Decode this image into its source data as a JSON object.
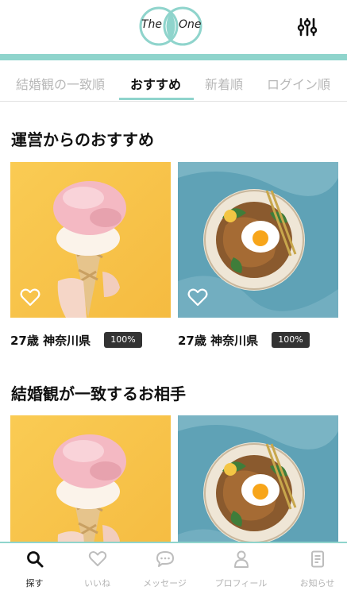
{
  "header": {
    "logo": {
      "word1": "The",
      "word2": "One"
    },
    "filter_icon": "sliders-icon",
    "accent_color": "#8fd4cc"
  },
  "tabs": [
    {
      "label": "結婚観の一致順",
      "active": false
    },
    {
      "label": "おすすめ",
      "active": true
    },
    {
      "label": "新着順",
      "active": false
    },
    {
      "label": "ログイン順",
      "active": false
    }
  ],
  "sections": [
    {
      "title": "運営からのおすすめ",
      "cards": [
        {
          "image": "ice-cream-photo",
          "age_location": "27歳 神奈川県",
          "match": "100%",
          "liked": false
        },
        {
          "image": "food-plate-photo",
          "age_location": "27歳 神奈川県",
          "match": "100%",
          "liked": false
        }
      ]
    },
    {
      "title": "結婚観が一致するお相手",
      "cards": [
        {
          "image": "ice-cream-photo"
        },
        {
          "image": "food-plate-photo"
        }
      ]
    }
  ],
  "bottom_nav": [
    {
      "label": "探す",
      "icon": "search-icon",
      "active": true
    },
    {
      "label": "いいね",
      "icon": "heart-icon",
      "active": false
    },
    {
      "label": "メッセージ",
      "icon": "chat-bubble-icon",
      "active": false
    },
    {
      "label": "プロフィール",
      "icon": "person-icon",
      "active": false
    },
    {
      "label": "お知らせ",
      "icon": "notice-icon",
      "active": false
    }
  ]
}
